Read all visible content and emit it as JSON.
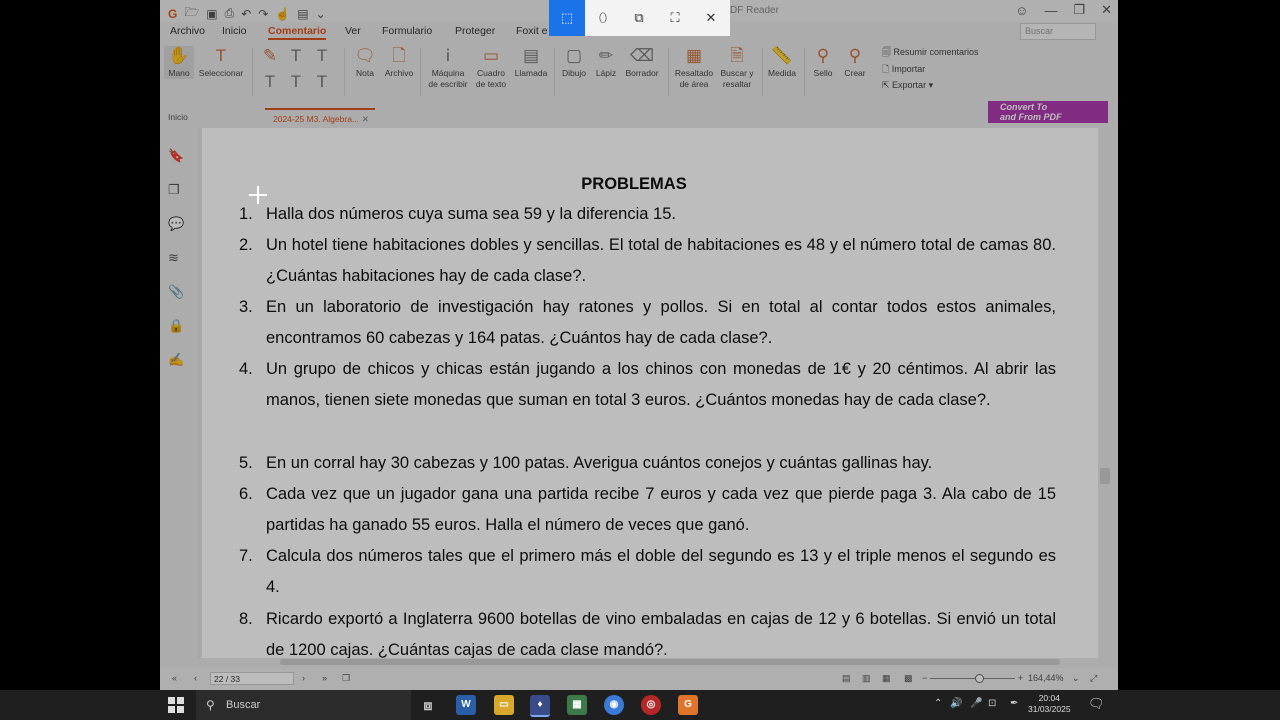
{
  "title_bar": {
    "title_fragment": "DF Reader",
    "search_placeholder": "Buscar"
  },
  "snip_toolbar": {
    "modes": [
      "rectangle",
      "freeform",
      "window",
      "fullscreen"
    ],
    "close_glyph": "✕"
  },
  "menu": {
    "items": [
      "Archivo",
      "Inicio",
      "Comentario",
      "Ver",
      "Formulario",
      "Proteger",
      "Foxit e"
    ],
    "active": "Comentario"
  },
  "ribbon": {
    "mano": "Mano",
    "seleccionar": "Seleccionar",
    "nota": "Nota",
    "archivo": "Archivo",
    "maquina_line1": "Máquina",
    "maquina_line2": "de escribir",
    "cuadro_line1": "Cuadro",
    "cuadro_line2": "de texto",
    "llamada": "Llamada",
    "dibujo": "Dibujo",
    "lapiz": "Lápiz",
    "borrador": "Borrador",
    "resaltado_line1": "Resaltado",
    "resaltado_line2": "de área",
    "buscar_line1": "Buscar y",
    "buscar_line2": "resaltar",
    "medida": "Medida",
    "sello": "Sello",
    "crear": "Crear",
    "resumir": "Resumir comentarios",
    "importar": "Importar",
    "exportar": "Exportar"
  },
  "convert_banner": {
    "line1": "Convert To",
    "line2": "and From PDF"
  },
  "tabs": {
    "home": "Inicio",
    "doc": "2024-25 M3. Algebra..."
  },
  "document": {
    "title": "PROBLEMAS",
    "problems": [
      {
        "num": "1.",
        "text": "Halla dos números cuya suma sea 59 y la diferencia 15."
      },
      {
        "num": "2.",
        "text": "Un hotel tiene habitaciones dobles y sencillas. El total de habitaciones es 48 y el número total de camas 80. ¿Cuántas habitaciones hay de cada clase?."
      },
      {
        "num": "3.",
        "text": "En un laboratorio de investigación hay ratones y pollos. Si en total al contar todos estos animales, encontramos 60 cabezas y 164 patas. ¿Cuántos hay de cada clase?."
      },
      {
        "num": "4.",
        "text": "Un grupo de chicos y chicas están jugando a los chinos con monedas de 1€ y 20 céntimos. Al abrir las manos, tienen siete monedas que suman en total 3 euros. ¿Cuántos monedas hay de cada clase?."
      },
      {
        "num": "5.",
        "text": "En un corral hay 30 cabezas y 100 patas. Averigua cuántos conejos y cuántas gallinas hay."
      },
      {
        "num": "6.",
        "text": "Cada vez que un jugador gana una partida recibe 7 euros y cada vez que pierde paga 3. Ala cabo de 15 partidas ha ganado 55 euros. Halla el número de veces que ganó."
      },
      {
        "num": "7.",
        "text": "Calcula dos números tales que el primero más el doble del segundo es 13 y el triple menos el segundo es 4."
      },
      {
        "num": "8.",
        "text": "Ricardo exportó a Inglaterra 9600 botellas de vino embaladas en cajas de 12 y 6 botellas. Si envió un total de 1200 cajas. ¿Cuántas cajas de cada clase mandó?."
      }
    ]
  },
  "status": {
    "page": "22 / 33",
    "zoom": "164,44%"
  },
  "taskbar": {
    "search_label": "Buscar",
    "time": "20:04",
    "date": "31/03/2025"
  }
}
